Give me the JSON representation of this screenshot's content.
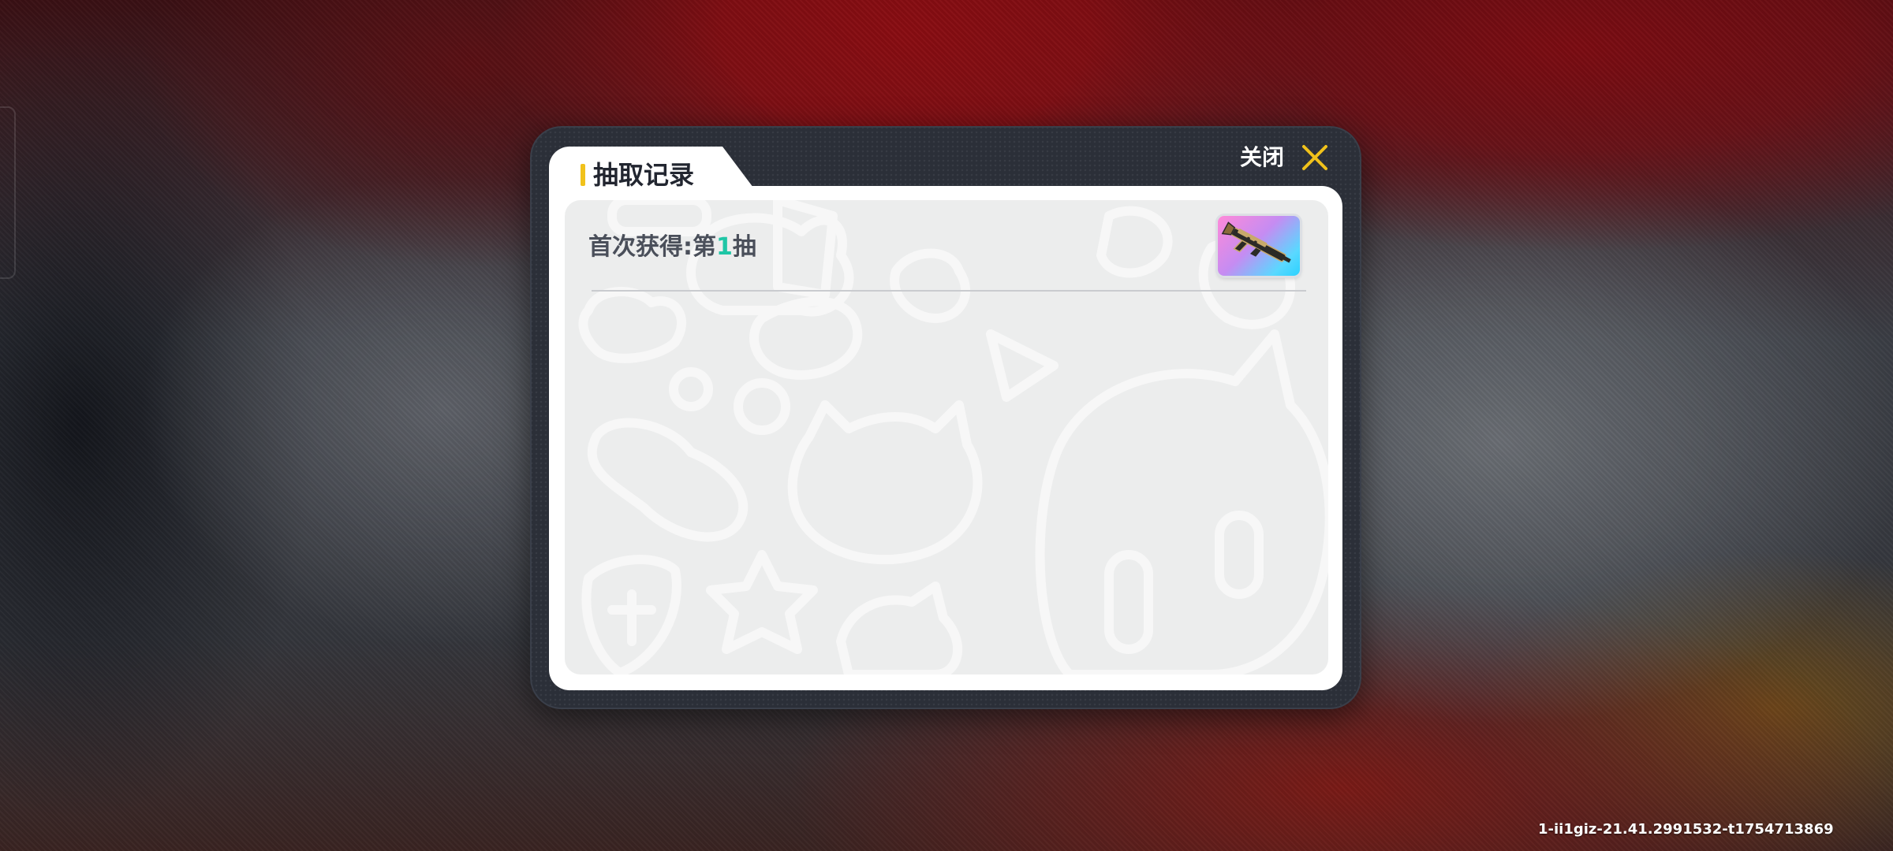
{
  "dialog": {
    "title": "抽取记录",
    "close_label": "关闭",
    "accent_color": "#f1c21b",
    "close_icon": "close-x-icon"
  },
  "records": [
    {
      "prefix": "首次获得:第",
      "draw_number": "1",
      "suffix": "抽",
      "number_color": "#1fc6a6",
      "item_icon": "rifle-weapon-icon",
      "item_rarity_colors": [
        "#ff8ad8",
        "#5ad8ff"
      ]
    }
  ],
  "build_id": "1-ii1giz-21.41.2991532-t1754713869"
}
